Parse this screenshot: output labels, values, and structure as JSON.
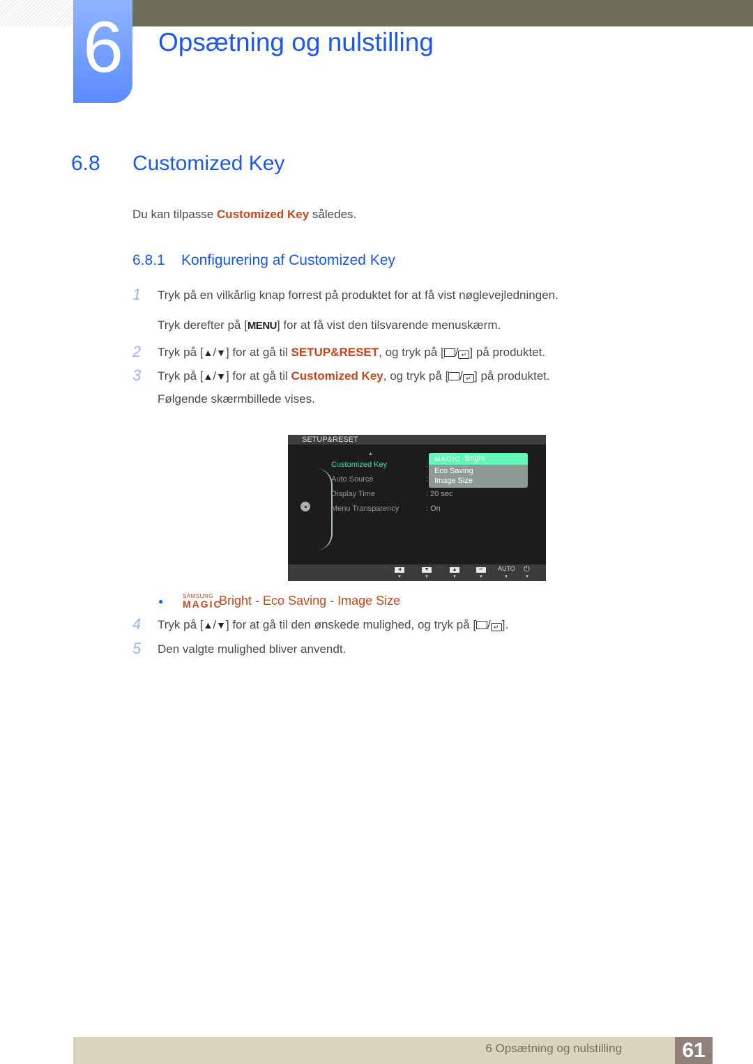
{
  "chapter": {
    "number": "6",
    "title": "Opsætning og nulstilling"
  },
  "section": {
    "number": "6.8",
    "title": "Customized Key"
  },
  "intro": {
    "prefix": "Du kan tilpasse ",
    "highlight": "Customized Key",
    "suffix": " således."
  },
  "subsection": {
    "number": "6.8.1",
    "title": "Konfigurering af Customized Key"
  },
  "steps": [
    {
      "number": "1",
      "text": "Tryk på en vilkårlig knap forrest på produktet for at få vist nøglevejledningen."
    },
    {
      "number": "",
      "prefix": "Tryk derefter på [",
      "key": "MENU",
      "suffix": "] for at få vist den tilsvarende menuskærm."
    },
    {
      "number": "2",
      "prefix": "Tryk på [",
      "mid": "] for at gå til ",
      "highlight": "SETUP&RESET",
      "mid2": ", og tryk på [",
      "suffix": "] på produktet."
    },
    {
      "number": "3",
      "prefix": "Tryk på [",
      "mid": "] for at gå til ",
      "highlight": "Customized Key",
      "mid2": ", og tryk på [",
      "suffix": "] på produktet."
    },
    {
      "number": "",
      "text": "Følgende skærmbillede vises."
    },
    {
      "number": "4",
      "prefix": "Tryk på [",
      "mid": "] for at gå til den ønskede mulighed, og tryk på [",
      "suffix": "]."
    },
    {
      "number": "5",
      "text": "Den valgte mulighed bliver anvendt."
    }
  ],
  "icons": {
    "up": "▲",
    "down": "▼",
    "slash": "/",
    "enter": "↵"
  },
  "osd": {
    "title": "SETUP&RESET",
    "menu_items": [
      {
        "label": "Customized Key",
        "value": ":"
      },
      {
        "label": "Auto Source",
        "value": ":"
      },
      {
        "label": "Display Time",
        "value": ": 20 sec"
      },
      {
        "label": "Menu Transparency",
        "value": ": On"
      }
    ],
    "dropdown": [
      {
        "brand_top": "SAMSUNG",
        "brand_bottom": "MAGIC",
        "label": "Bright"
      },
      {
        "label": "Eco Saving"
      },
      {
        "label": "Image Size"
      }
    ],
    "buttons": [
      "◄",
      "▼",
      "▲",
      "↵",
      "AUTO",
      "⏻"
    ],
    "colors": {
      "highlight": "#60f7b8",
      "selected_text": "#43e0a0"
    }
  },
  "options_line": {
    "brand_top": "SAMSUNG",
    "brand_bottom": "MAGIC",
    "opt1": "Bright",
    "sep": " - ",
    "opt2": "Eco Saving",
    "opt3": "Image Size"
  },
  "footer": {
    "text": "6 Opsætning og nulstilling",
    "page": "61"
  },
  "colors": {
    "heading": "#1a56f0",
    "highlight": "#c5461a",
    "footer_bg": "#dad3be",
    "page_box": "#8f8177"
  }
}
